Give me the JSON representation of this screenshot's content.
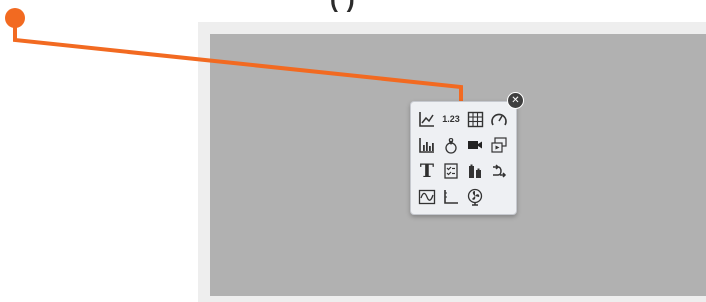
{
  "header": {
    "cutoff_title": "(              )"
  },
  "palette": {
    "items": [
      {
        "name": "line-chart",
        "label": ""
      },
      {
        "name": "number-display",
        "label": "1.23"
      },
      {
        "name": "table",
        "label": ""
      },
      {
        "name": "gauge",
        "label": ""
      },
      {
        "name": "bar-chart",
        "label": ""
      },
      {
        "name": "map-pin",
        "label": ""
      },
      {
        "name": "video-camera",
        "label": ""
      },
      {
        "name": "media-player",
        "label": ""
      },
      {
        "name": "text",
        "label": "T"
      },
      {
        "name": "checklist",
        "label": ""
      },
      {
        "name": "battery-level",
        "label": ""
      },
      {
        "name": "switch",
        "label": ""
      },
      {
        "name": "trend-waveform",
        "label": ""
      },
      {
        "name": "axis-plot",
        "label": ""
      },
      {
        "name": "fan",
        "label": ""
      }
    ],
    "close_label": "✕"
  },
  "colors": {
    "accent": "#f26a21",
    "canvas": "#b1b1b1",
    "workspace": "#eeeeee"
  }
}
